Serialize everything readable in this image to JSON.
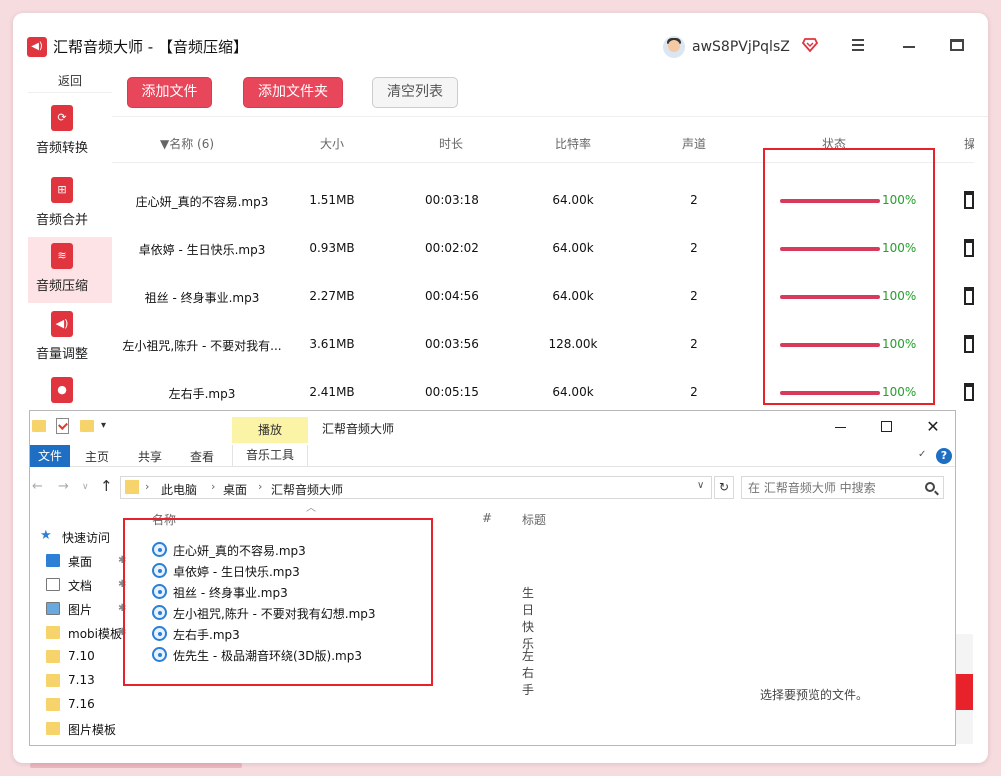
{
  "app": {
    "title": "汇帮音频大师  - 【音频压缩】",
    "user_name": "awS8PVjPqlsZ",
    "accent_color": "#e0343f",
    "window_controls": [
      "menu-icon",
      "minimize-icon",
      "maximize-icon"
    ]
  },
  "sidebar": {
    "back_label": "返回",
    "items": [
      {
        "label": "音频转换",
        "icon": "audio-convert-icon"
      },
      {
        "label": "音频合并",
        "icon": "audio-merge-icon"
      },
      {
        "label": "音频压缩",
        "icon": "audio-compress-icon",
        "active": true
      },
      {
        "label": "音量调整",
        "icon": "volume-adjust-icon"
      },
      {
        "label": "",
        "icon": "microphone-icon"
      }
    ]
  },
  "toolbar": {
    "add_file": "添加文件",
    "add_folder": "添加文件夹",
    "clear_list": "清空列表"
  },
  "table": {
    "headers": {
      "name": "▼名称 (6)",
      "size": "大小",
      "duration": "时长",
      "bitrate": "比特率",
      "channels": "声道",
      "status": "状态",
      "action": "操"
    },
    "rows": [
      {
        "name": "庄心妍_真的不容易.mp3",
        "size": "1.51MB",
        "duration": "00:03:18",
        "bitrate": "64.00k",
        "channels": "2",
        "progress": 100,
        "progress_label": "100%"
      },
      {
        "name": "卓依婷 - 生日快乐.mp3",
        "size": "0.93MB",
        "duration": "00:02:02",
        "bitrate": "64.00k",
        "channels": "2",
        "progress": 100,
        "progress_label": "100%"
      },
      {
        "name": "祖丝 - 终身事业.mp3",
        "size": "2.27MB",
        "duration": "00:04:56",
        "bitrate": "64.00k",
        "channels": "2",
        "progress": 100,
        "progress_label": "100%"
      },
      {
        "name": "左小祖咒,陈升 - 不要对我有...",
        "size": "3.61MB",
        "duration": "00:03:56",
        "bitrate": "128.00k",
        "channels": "2",
        "progress": 100,
        "progress_label": "100%"
      },
      {
        "name": "左右手.mp3",
        "size": "2.41MB",
        "duration": "00:05:15",
        "bitrate": "64.00k",
        "channels": "2",
        "progress": 100,
        "progress_label": "100%"
      }
    ],
    "progress_color": "#d63a5c",
    "percent_color": "#22a02a"
  },
  "explorer": {
    "play_tab": "播放",
    "title": "汇帮音频大师",
    "ribbon_tabs": {
      "file": "文件",
      "home": "主页",
      "share": "共享",
      "view": "查看",
      "music_tools": "音乐工具"
    },
    "address": {
      "pc": "此电脑",
      "desktop": "桌面",
      "folder": "汇帮音频大师"
    },
    "search_placeholder": "在 汇帮音频大师 中搜索",
    "nav": [
      {
        "label": "快速访问",
        "icon": "star-icon"
      },
      {
        "label": "桌面",
        "icon": "desktop-icon",
        "pinned": true
      },
      {
        "label": "文档",
        "icon": "document-icon",
        "pinned": true
      },
      {
        "label": "图片",
        "icon": "picture-icon",
        "pinned": true
      },
      {
        "label": "mobi模板",
        "icon": "folder-icon",
        "pinned": true
      },
      {
        "label": "7.10",
        "icon": "folder-icon"
      },
      {
        "label": "7.13",
        "icon": "folder-icon"
      },
      {
        "label": "7.16",
        "icon": "folder-icon"
      },
      {
        "label": "图片模板",
        "icon": "folder-icon"
      }
    ],
    "columns": {
      "name": "名称",
      "num": "#",
      "title": "标题"
    },
    "files": [
      {
        "name": "庄心妍_真的不容易.mp3",
        "title": ""
      },
      {
        "name": "卓依婷 - 生日快乐.mp3",
        "title": "生日快乐"
      },
      {
        "name": "祖丝 - 终身事业.mp3",
        "title": ""
      },
      {
        "name": "左小祖咒,陈升 - 不要对我有幻想.mp3",
        "title": ""
      },
      {
        "name": "左右手.mp3",
        "title": "左右手"
      },
      {
        "name": "佐先生 - 极品潮音环绕(3D版).mp3",
        "title": ""
      }
    ],
    "preview_text": "选择要预览的文件。",
    "annotation_color": "#e8222a"
  }
}
